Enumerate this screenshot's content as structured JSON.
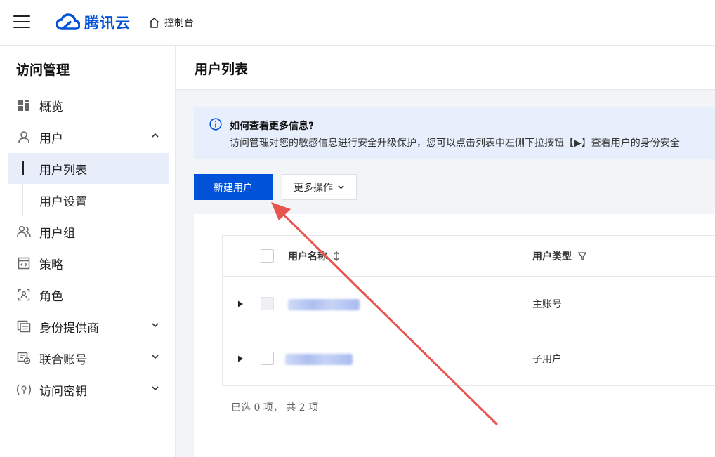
{
  "topbar": {
    "brand": "腾讯云",
    "console_label": "控制台"
  },
  "sidebar": {
    "title": "访问管理",
    "items": [
      {
        "label": "概览",
        "icon": "dashboard-icon"
      },
      {
        "label": "用户",
        "icon": "user-icon",
        "expanded": true
      },
      {
        "label": "用户列表",
        "sub": true,
        "active": true
      },
      {
        "label": "用户设置",
        "sub": true
      },
      {
        "label": "用户组",
        "icon": "user-group-icon"
      },
      {
        "label": "策略",
        "icon": "policy-icon"
      },
      {
        "label": "角色",
        "icon": "role-icon"
      },
      {
        "label": "身份提供商",
        "icon": "identity-provider-icon"
      },
      {
        "label": "联合账号",
        "icon": "federated-account-icon"
      },
      {
        "label": "访问密钥",
        "icon": "access-key-icon"
      }
    ]
  },
  "main": {
    "page_title": "用户列表",
    "notice": {
      "title": "如何查看更多信息?",
      "text": "访问管理对您的敏感信息进行安全升级保护，您可以点击列表中左侧下拉按钮【▶】查看用户的身份安全"
    },
    "buttons": {
      "create_user": "新建用户",
      "more_actions": "更多操作"
    },
    "table": {
      "columns": [
        "用户名称",
        "用户类型"
      ],
      "rows": [
        {
          "type": "主账号",
          "selectable": false
        },
        {
          "type": "子用户",
          "selectable": true
        }
      ]
    },
    "footer": "已选 0 项， 共 2 项"
  },
  "colors": {
    "primary": "#0052d9",
    "annotation_arrow": "#e8544e",
    "notice_bg": "#e8effc",
    "active_nav_bg": "#e8edfa"
  }
}
